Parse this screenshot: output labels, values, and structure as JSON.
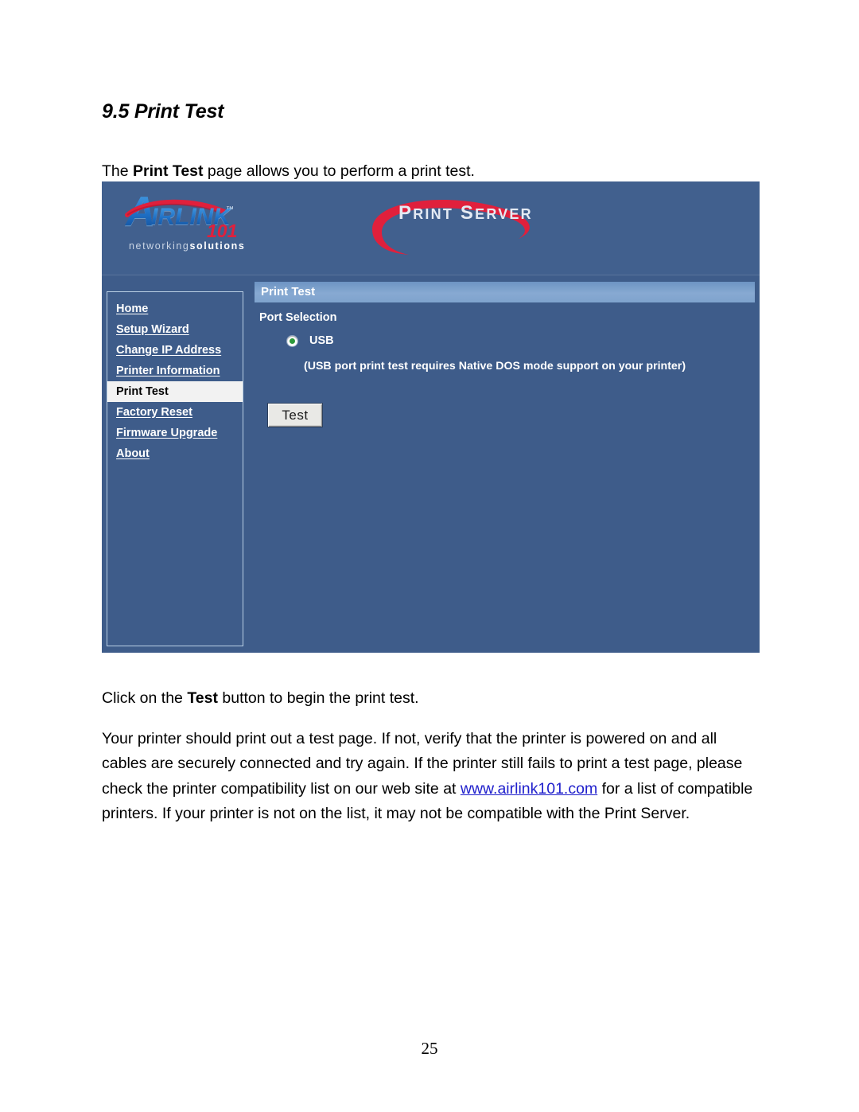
{
  "document": {
    "section_heading": "9.5 Print Test",
    "intro_prefix": "The ",
    "intro_bold": "Print Test",
    "intro_suffix": " page allows you to perform a print test.",
    "click_prefix": "Click on the ",
    "click_bold": "Test",
    "click_suffix": " button to begin the print test.",
    "detail_before_link": "Your printer should print out a test page. If not, verify that the printer is powered on and all cables are securely connected and try again. If the printer still fails to print a test page, please check the printer compatibility list on our web site at ",
    "detail_link": "www.airlink101.com",
    "detail_after_link": " for a list of compatible printers. If your printer is not on the list, it may not be compatible with the Print Server.",
    "page_number": "25"
  },
  "screenshot": {
    "header": {
      "logo_letter": "A",
      "logo_word": "IRLINK",
      "logo_trademark": "™",
      "logo_number": "101",
      "tagline_light": "networking",
      "tagline_bold": "solutions",
      "brand_p": "P",
      "brand_rint": "RINT",
      "brand_s": "S",
      "brand_erver": "ERVER"
    },
    "sidebar": {
      "items": [
        {
          "label": "Home",
          "active": false
        },
        {
          "label": "Setup Wizard",
          "active": false
        },
        {
          "label": "Change IP Address",
          "active": false
        },
        {
          "label": "Printer Information",
          "active": false
        },
        {
          "label": "Print Test",
          "active": true
        },
        {
          "label": "Factory Reset",
          "active": false
        },
        {
          "label": "Firmware Upgrade",
          "active": false
        },
        {
          "label": "About",
          "active": false
        }
      ]
    },
    "main": {
      "panel_title": "Print Test",
      "port_selection_label": "Port Selection",
      "radio_usb_label": "USB",
      "radio_usb_selected": true,
      "hint_note": "(USB port print test requires Native DOS mode support on your printer)",
      "test_button_label": "Test"
    },
    "colors": {
      "panel_background": "#3e5c8a",
      "panel_title_gradient_top": "#6d94c3",
      "panel_title_gradient_bottom": "#7fa3cd",
      "nav_border": "#b9cfe4",
      "active_item_background": "#f2f2f2",
      "logo_blue": "#1f6fc4",
      "logo_red": "#e0203c",
      "radio_dot_green": "#2e9a3b",
      "link_blue": "#2020cc"
    }
  }
}
